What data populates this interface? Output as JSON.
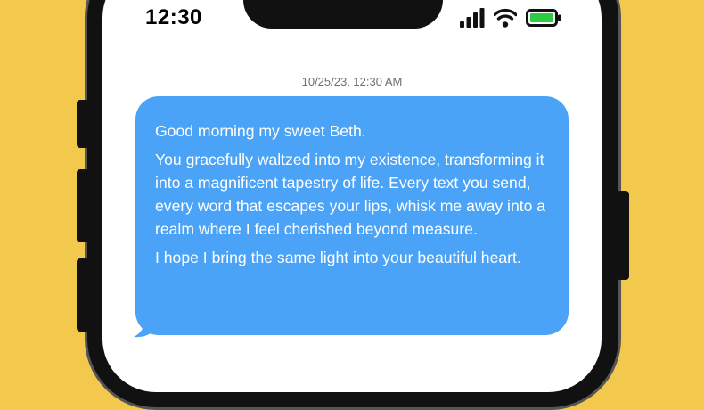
{
  "status_bar": {
    "time": "12:30",
    "icons": [
      "cellular-signal-icon",
      "wifi-icon",
      "battery-icon"
    ],
    "battery_color": "#2ecc40"
  },
  "conversation": {
    "timestamp": "10/25/23, 12:30 AM",
    "message": {
      "paragraphs": [
        "Good morning my sweet Beth.",
        "You gracefully waltzed into my existence, transforming it into a magnificent tapestry of life. Every text you send, every word that escapes your lips, whisk me away into a realm where I feel cherished beyond measure.",
        "I hope I bring the same light into your beautiful heart."
      ],
      "bubble_color": "#4aa3f7"
    }
  },
  "colors": {
    "background": "#f2c94c",
    "phone_frame": "#111111",
    "screen": "#ffffff"
  }
}
